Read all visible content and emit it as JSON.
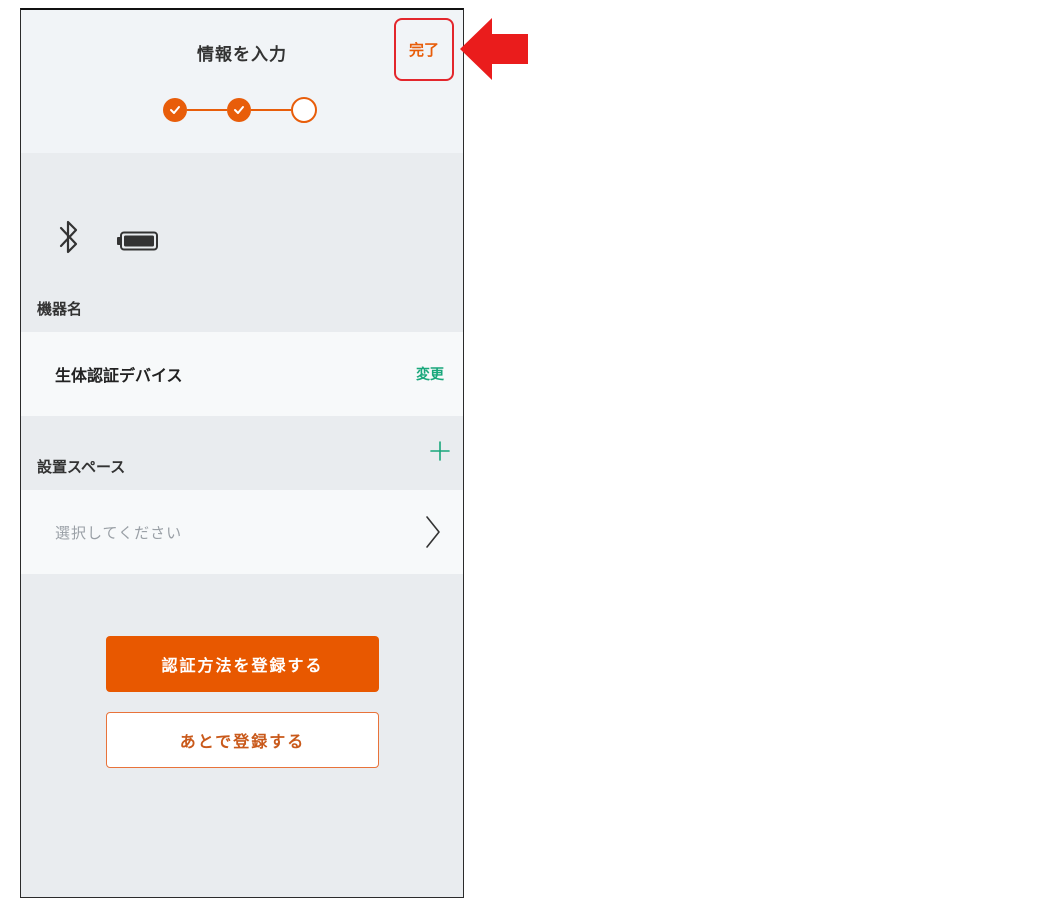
{
  "header": {
    "title": "情報を入力",
    "done_label": "完了"
  },
  "stepper": {
    "steps_completed": 2,
    "steps_total": 3
  },
  "status_icons": [
    "bluetooth-icon",
    "battery-icon"
  ],
  "device": {
    "section_label": "機器名",
    "name": "生体認証デバイス",
    "change_label": "変更"
  },
  "space": {
    "section_label": "設置スペース",
    "placeholder": "選択してください"
  },
  "actions": {
    "register_label": "認証方法を登録する",
    "later_label": "あとで登録する"
  },
  "colors": {
    "accent": "#e85800",
    "green": "#19a77b",
    "highlight": "#e3262c"
  }
}
